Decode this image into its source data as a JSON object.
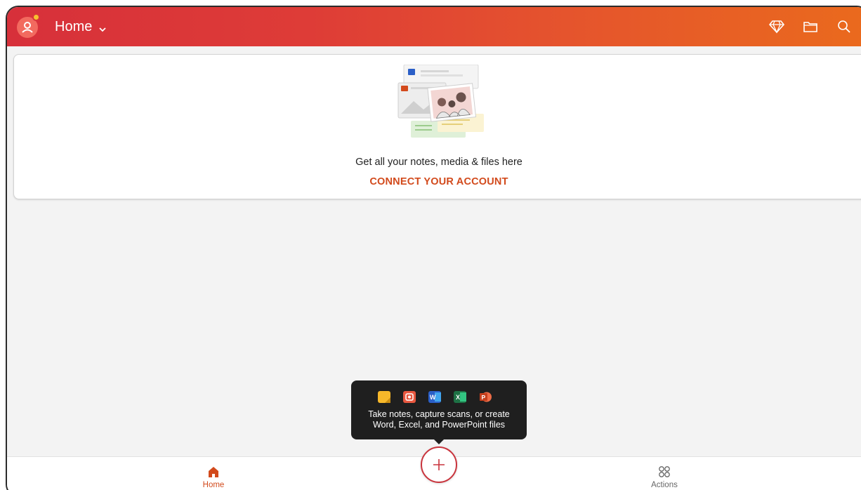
{
  "header": {
    "title": "Home",
    "icons": [
      "avatar-icon",
      "premium-diamond-icon",
      "folder-icon",
      "search-icon"
    ],
    "gradient": [
      "#d7303a",
      "#ea6a1d"
    ]
  },
  "card": {
    "message": "Get all your notes, media & files here",
    "link": "CONNECT YOUR ACCOUNT",
    "link_color": "#d24a1c"
  },
  "tooltip": {
    "text_line1": "Take notes, capture scans, or create",
    "text_line2": "Word, Excel, and PowerPoint files",
    "icons": [
      "sticky-note-icon",
      "scan-camera-icon",
      "word-icon",
      "excel-icon",
      "powerpoint-icon"
    ]
  },
  "bottom_nav": {
    "home_label": "Home",
    "actions_label": "Actions",
    "active": "Home"
  },
  "fab": {
    "icon": "plus-icon"
  }
}
